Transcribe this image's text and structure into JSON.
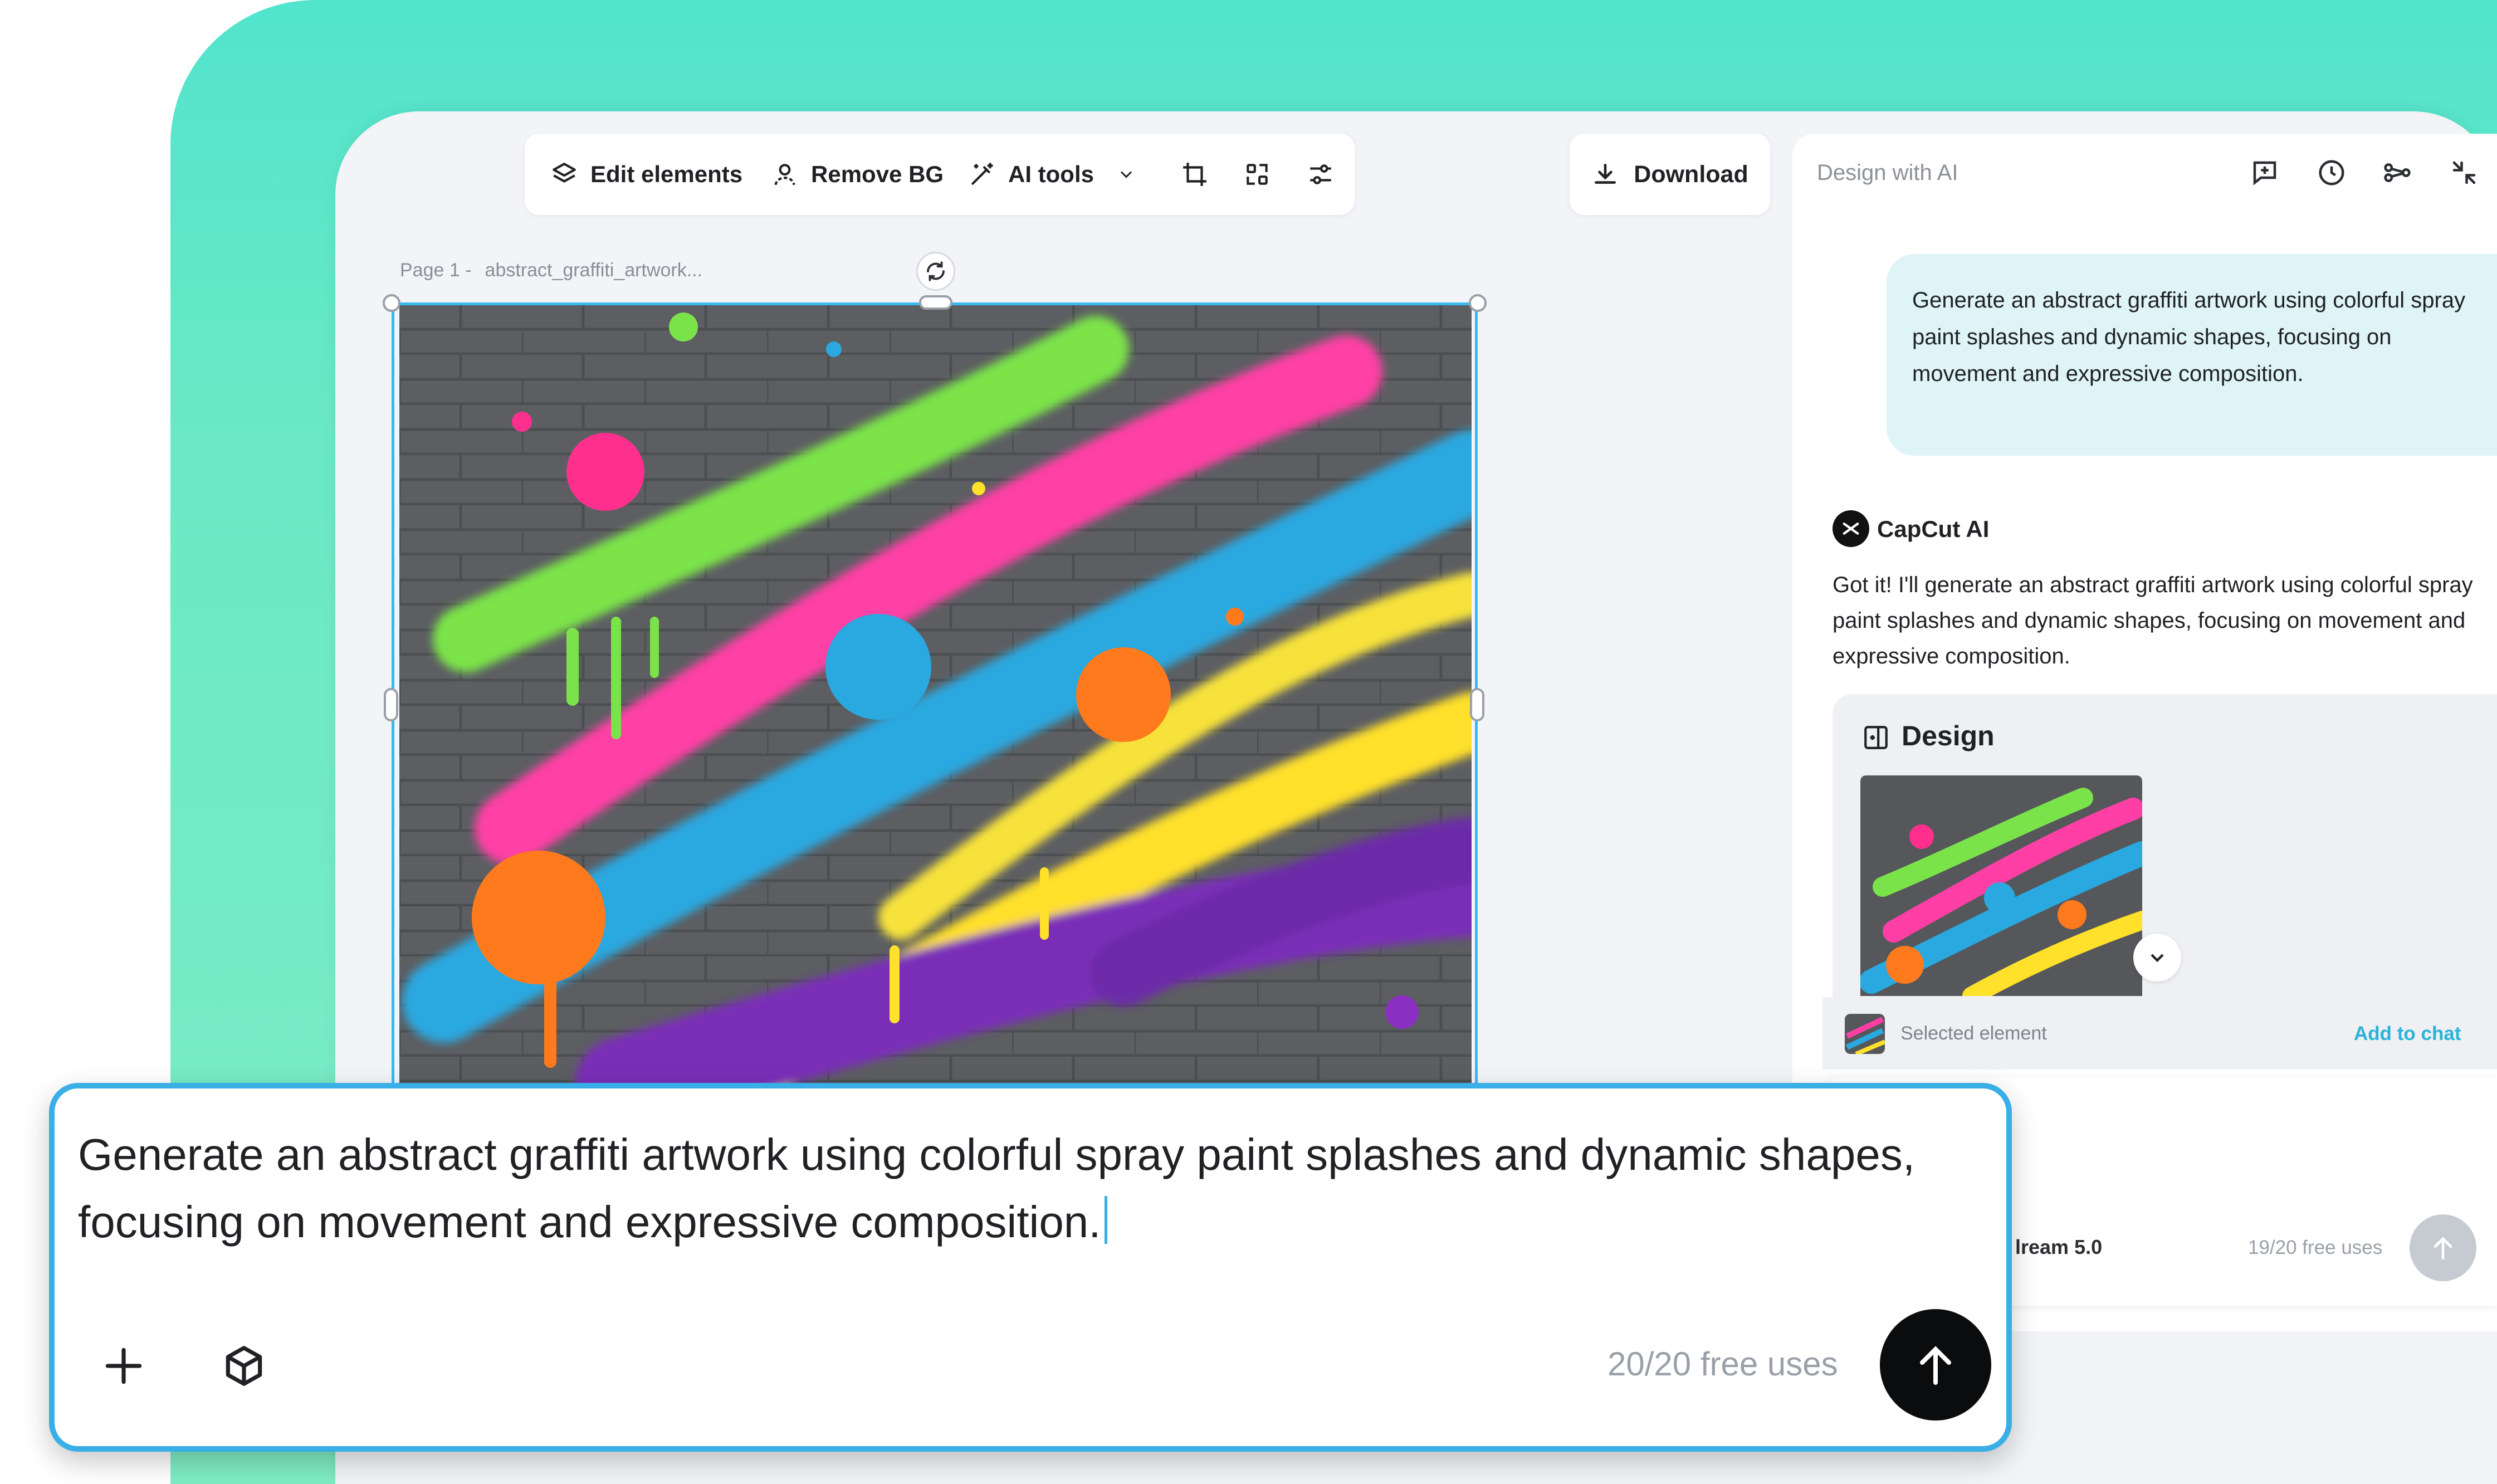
{
  "colors": {
    "backdrop": "#52e4cd",
    "selection": "#38b9f0",
    "accent_link": "#2ab3d9",
    "send_button": "#0b0c0e"
  },
  "toolbar": {
    "edit_elements_label": "Edit elements",
    "remove_bg_label": "Remove BG",
    "ai_tools_label": "AI tools",
    "icons": [
      "layers-icon",
      "person-icon",
      "magic-wand-icon",
      "chevron-down-icon",
      "crop-icon",
      "resize-icon",
      "adjust-icon"
    ]
  },
  "download": {
    "label": "Download",
    "icon": "download-icon"
  },
  "canvas": {
    "page_label": "Page 1 -",
    "file_name": "abstract_graffiti_artwork..."
  },
  "panel": {
    "title": "Design with AI",
    "icons": [
      "new-chat-icon",
      "history-icon",
      "share-icon",
      "collapse-icon"
    ],
    "user_message": "Generate an abstract graffiti artwork using colorful spray paint splashes and dynamic shapes, focusing on movement and expressive composition.",
    "bot_name": "CapCut AI",
    "bot_reply": "Got it! I'll generate an abstract graffiti artwork using colorful spray paint splashes and dynamic shapes, focusing on movement and expressive composition.",
    "design_card_title": "Design",
    "selected_element_label": "Selected element",
    "add_to_chat_label": "Add to chat",
    "model_label": "lream 5.0",
    "small_free_uses": "19/20 free uses"
  },
  "prompt": {
    "text": "Generate an abstract graffiti artwork using colorful spray paint splashes and dynamic shapes, focusing on movement and expressive composition.",
    "free_uses": "20/20 free uses",
    "icons": [
      "plus-icon",
      "cube-icon",
      "arrow-up-icon"
    ]
  }
}
